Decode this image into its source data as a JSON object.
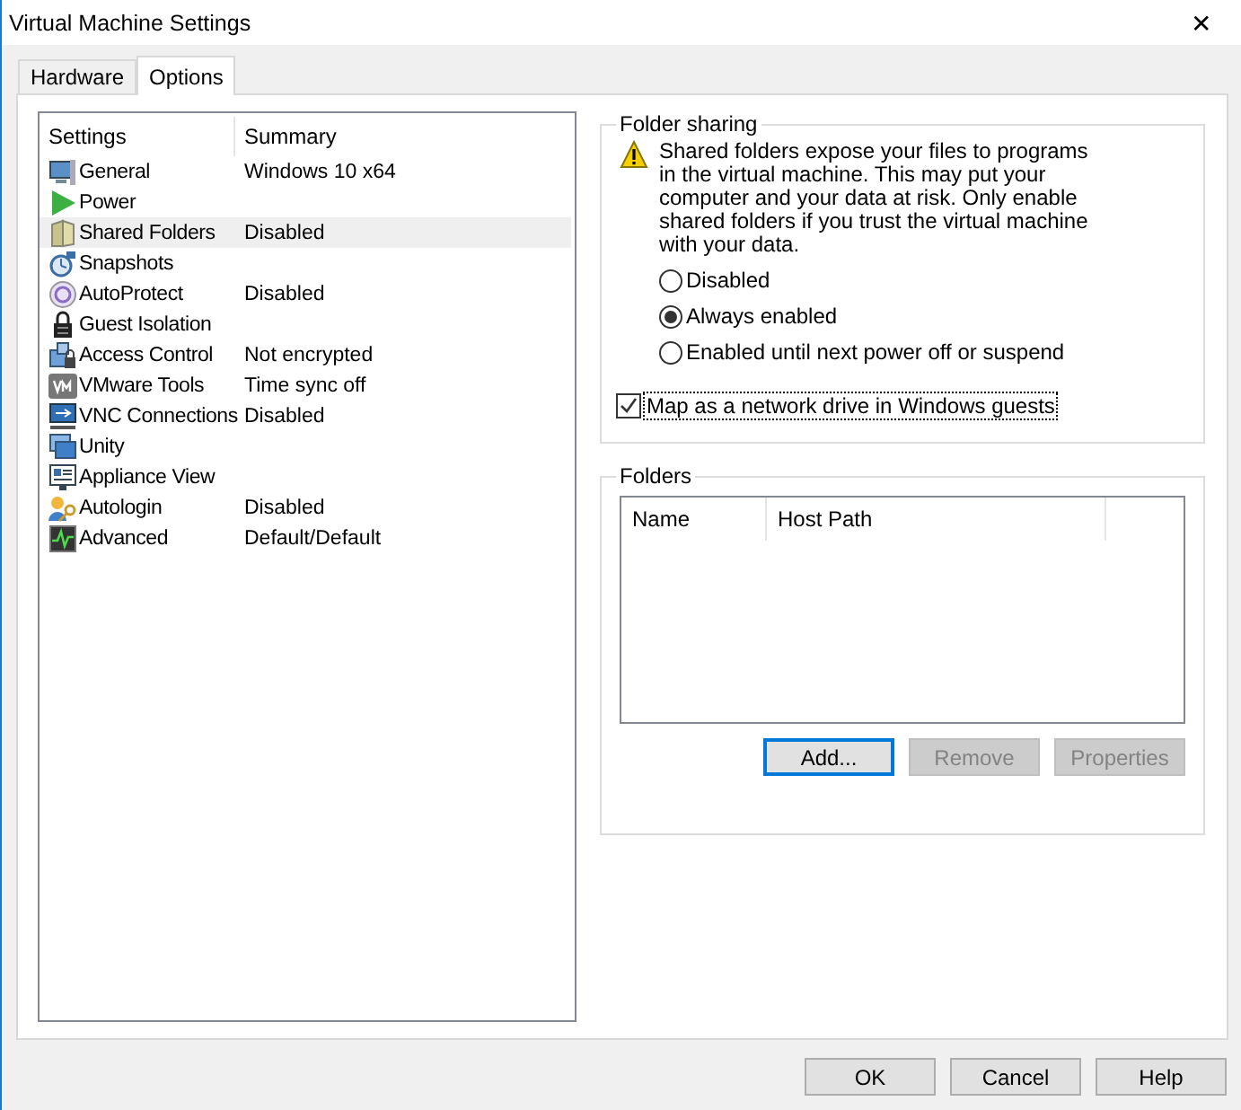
{
  "window": {
    "title": "Virtual Machine Settings",
    "close": "✕"
  },
  "tabs": [
    {
      "label": "Hardware",
      "selected": false
    },
    {
      "label": "Options",
      "selected": true
    }
  ],
  "settings": {
    "columns": [
      "Settings",
      "Summary"
    ],
    "items": [
      {
        "name": "General",
        "summary": "Windows 10 x64",
        "selected": false
      },
      {
        "name": "Power",
        "selected": false
      },
      {
        "name": "Shared Folders",
        "summary": "Disabled",
        "selected": true
      },
      {
        "name": "Snapshots",
        "selected": false
      },
      {
        "name": "AutoProtect",
        "summary": "Disabled",
        "selected": false
      },
      {
        "name": "Guest Isolation",
        "selected": false
      },
      {
        "name": "Access Control",
        "summary": "Not encrypted",
        "selected": false
      },
      {
        "name": "VMware Tools",
        "summary": "Time sync off",
        "selected": false
      },
      {
        "name": "VNC Connections",
        "summary": "Disabled",
        "selected": false
      },
      {
        "name": "Unity",
        "selected": false
      },
      {
        "name": "Appliance View",
        "selected": false
      },
      {
        "name": "Autologin",
        "summary": "Disabled",
        "selected": false
      },
      {
        "name": "Advanced",
        "summary": "Default/Default",
        "selected": false
      }
    ]
  },
  "folder_sharing": {
    "title": "Folder sharing",
    "warning": "Shared folders expose your files to programs in the virtual machine. This may put your computer and your data at risk. Only enable shared folders if you trust the virtual machine with your data.",
    "options": [
      {
        "label": "Disabled",
        "selected": false
      },
      {
        "label": "Always enabled",
        "selected": true
      },
      {
        "label": "Enabled until next power off or suspend",
        "selected": false
      }
    ],
    "map_drive": {
      "label": "Map as a network drive in Windows guests",
      "checked": true
    }
  },
  "folders": {
    "title": "Folders",
    "columns": [
      "Name",
      "Host Path"
    ],
    "buttons": [
      {
        "label": "Add...",
        "disabled": false,
        "focused": true
      },
      {
        "label": "Remove",
        "disabled": true,
        "focused": false
      },
      {
        "label": "Properties",
        "disabled": true,
        "focused": false
      }
    ]
  },
  "buttons": [
    {
      "label": "OK"
    },
    {
      "label": "Cancel"
    },
    {
      "label": "Help"
    }
  ]
}
